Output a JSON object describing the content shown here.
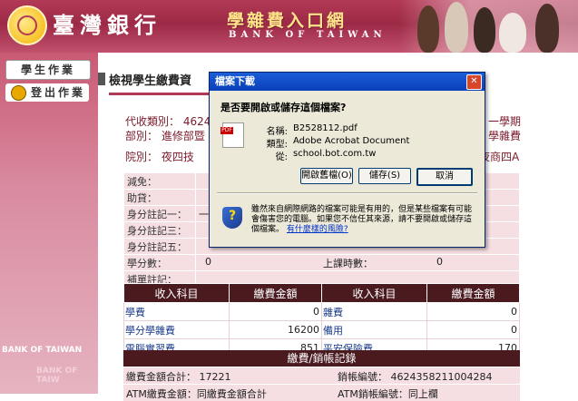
{
  "header": {
    "bank_name": "臺灣銀行",
    "system_title": "學雜費入口網",
    "system_subtitle": "BANK OF TAIWAN"
  },
  "sidebar": {
    "student_btn": "學生作業",
    "logout_btn": "登出作業",
    "watermark1": "BANK OF TAIWAN",
    "watermark2": "BANK OF TAIW"
  },
  "page": {
    "title": "檢視學生繳費資",
    "line1_left": "代收類別： 4624",
    "line1_right": "一學期",
    "line2_left": "部別： 進修部暨",
    "line2_right": "學雜費",
    "line3_left": "院別： 夜四技",
    "line3_right": "夜商四A"
  },
  "form_rows": [
    {
      "label": "減免：",
      "value": ""
    },
    {
      "label": "助貸：",
      "value": ""
    },
    {
      "label": "身分註記一：",
      "value": "一"
    },
    {
      "label": "身分註記三：",
      "value": ""
    },
    {
      "label": "身分註記五：",
      "value": ""
    }
  ],
  "credits": {
    "label": "學分數：",
    "value": "0",
    "hours_label": "上課時數：",
    "hours_value": "0"
  },
  "supp": {
    "label": "補單註記："
  },
  "fees": {
    "headers": [
      "收入科目",
      "繳費金額",
      "收入科目",
      "繳費金額"
    ],
    "rows": [
      {
        "item1": "學費",
        "amt1": "0",
        "item2": "雜費",
        "amt2": "0"
      },
      {
        "item1": "學分學雜費",
        "amt1": "16200",
        "item2": "備用",
        "amt2": "0"
      },
      {
        "item1": "電腦實習費",
        "amt1": "851",
        "item2": "平安保險費",
        "amt2": "170"
      }
    ]
  },
  "record": {
    "header": "繳費/銷帳記錄",
    "total_label": "繳費金額合計： 17221",
    "account_label": "銷帳編號： 4624358211004284",
    "atm_left": "ATM繳費金額：同繳費金額合計",
    "atm_right": "ATM銷帳編號：同上欄"
  },
  "dialog": {
    "title": "檔案下載",
    "question": "是否要開啟或儲存這個檔案?",
    "name_label": "名稱:",
    "name_value": "B2528112.pdf",
    "type_label": "類型:",
    "type_value": "Adobe Acrobat Document",
    "from_label": "從:",
    "from_value": "school.bot.com.tw",
    "open_btn": "開啟舊檔(O)",
    "save_btn": "儲存(S)",
    "cancel_btn": "取消",
    "warning": "雖然來自網際網路的檔案可能是有用的，但是某些檔案有可能會傷害您的電腦。如果您不信任其來源，請不要開啟或儲存這個檔案。",
    "risk_link": "有什麼樣的風險?",
    "pdf_badge": "PDF"
  },
  "colors": {
    "brand": "#b33a57",
    "dark_header": "#4a1a1e",
    "row_bg": "#f5dfe3"
  }
}
